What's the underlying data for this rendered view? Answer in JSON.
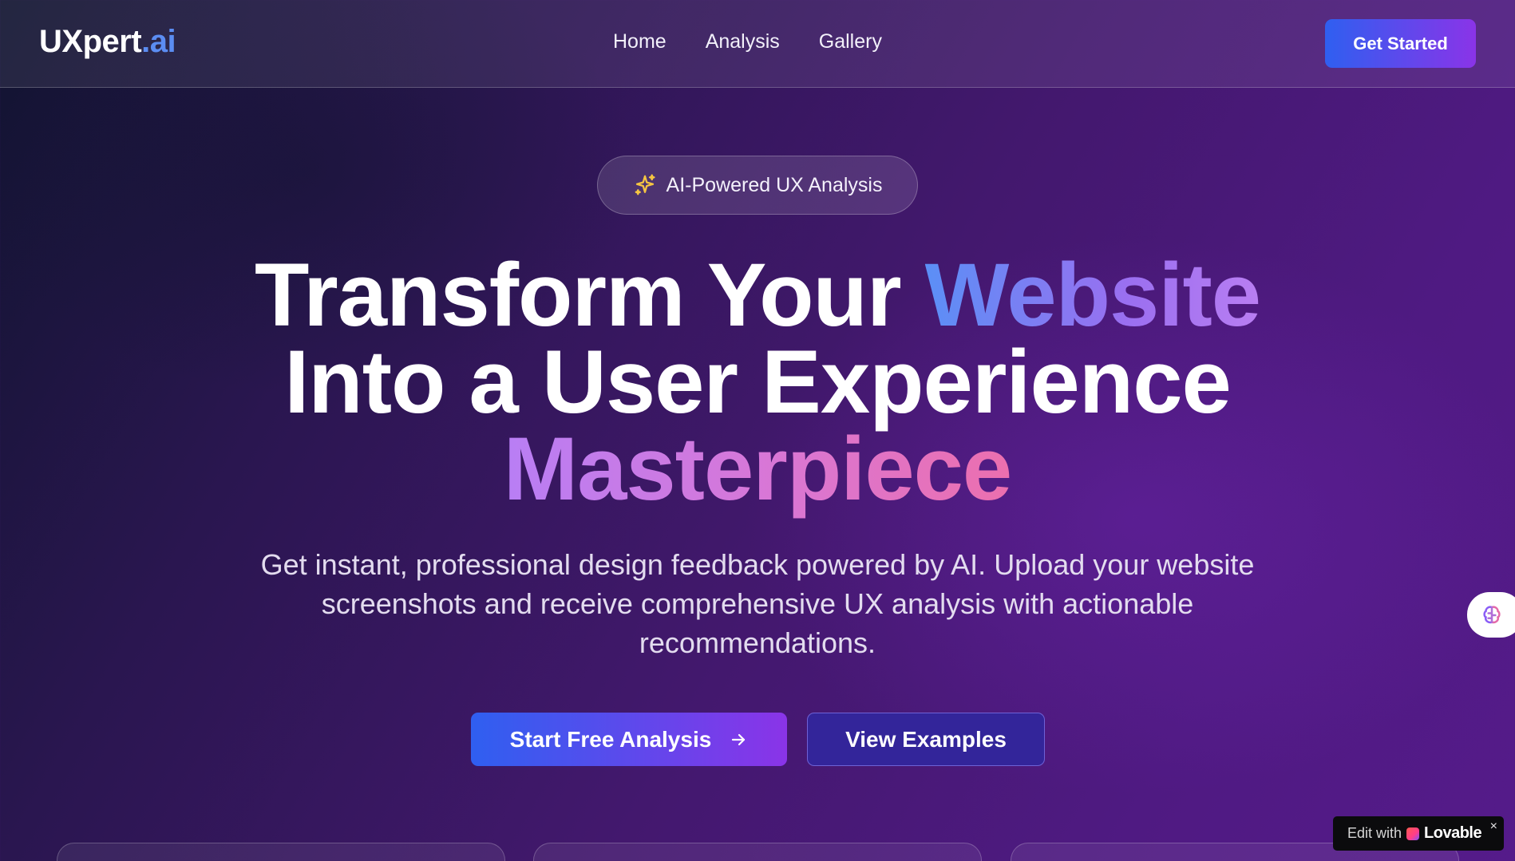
{
  "nav": {
    "logo_main": "UXpert",
    "logo_accent": ".ai",
    "links": [
      "Home",
      "Analysis",
      "Gallery"
    ],
    "cta_label": "Get Started"
  },
  "hero": {
    "badge_icon": "sparkles-icon",
    "badge_label": "AI-Powered UX Analysis",
    "headline_line1_a": "Transform Your ",
    "headline_line1_b": "Website",
    "headline_line2": "Into a User Experience",
    "headline_line3": "Masterpiece",
    "subtitle": "Get instant, professional design feedback powered by AI. Upload your website screenshots and receive comprehensive UX analysis with actionable recommendations.",
    "primary_button": "Start Free Analysis",
    "primary_button_icon": "arrow-right-icon",
    "secondary_button": "View Examples"
  },
  "widgets": {
    "side_icon": "brain-icon",
    "lovable_prefix": "Edit with",
    "lovable_brand": "Lovable",
    "lovable_close": "×"
  },
  "colors": {
    "accent_blue": "#5b8df2",
    "button_gradient_start": "#2f5ff0",
    "button_gradient_end": "#8a34e8",
    "secondary_button": "#33259a",
    "sparkle_yellow": "#f5c542"
  }
}
